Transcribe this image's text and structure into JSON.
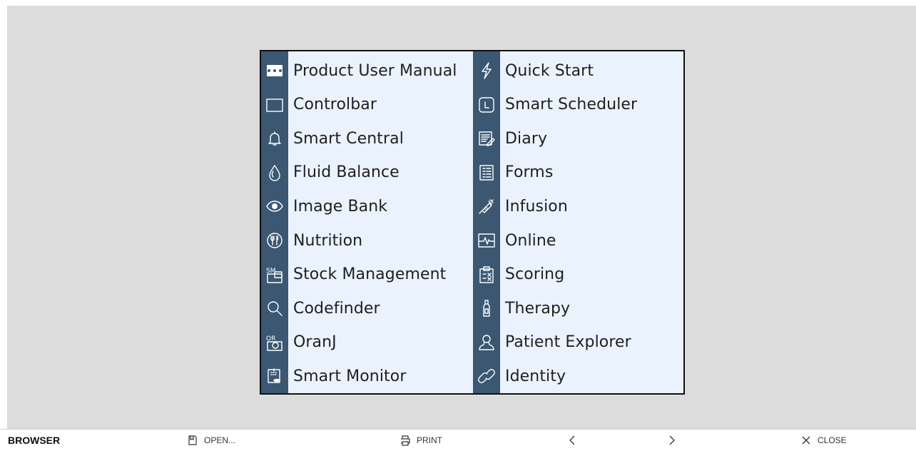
{
  "left_items": [
    {
      "label": "Product User Manual",
      "icon": "manual-icon"
    },
    {
      "label": "Controlbar",
      "icon": "controlbar-icon"
    },
    {
      "label": "Smart Central",
      "icon": "bell-icon"
    },
    {
      "label": "Fluid Balance",
      "icon": "drop-icon"
    },
    {
      "label": "Image Bank",
      "icon": "eye-icon"
    },
    {
      "label": "Nutrition",
      "icon": "cutlery-icon"
    },
    {
      "label": "Stock Management",
      "icon": "sm-box-icon"
    },
    {
      "label": "Codefinder",
      "icon": "search-icon"
    },
    {
      "label": "OranJ",
      "icon": "or-icon"
    },
    {
      "label": "Smart Monitor",
      "icon": "monitor-icon"
    }
  ],
  "right_items": [
    {
      "label": "Quick Start",
      "icon": "lightning-icon"
    },
    {
      "label": "Smart Scheduler",
      "icon": "scheduler-icon"
    },
    {
      "label": "Diary",
      "icon": "diary-icon"
    },
    {
      "label": "Forms",
      "icon": "forms-icon"
    },
    {
      "label": "Infusion",
      "icon": "syringe-icon"
    },
    {
      "label": "Online",
      "icon": "ecg-icon"
    },
    {
      "label": "Scoring",
      "icon": "clipboard-icon"
    },
    {
      "label": "Therapy",
      "icon": "bottle-icon"
    },
    {
      "label": "Patient Explorer",
      "icon": "person-icon"
    },
    {
      "label": "Identity",
      "icon": "link-icon"
    }
  ],
  "statusbar": {
    "brand": "BROWSER",
    "open_label": "OPEN...",
    "print_label": "PRINT",
    "prev_icon": "chevron-left-icon",
    "next_icon": "chevron-right-icon",
    "close_label": "CLOSE"
  },
  "colors": {
    "rail": "#3b5772",
    "panel_bg": "#eaf2fd",
    "stage_bg": "#dcdcdc"
  }
}
